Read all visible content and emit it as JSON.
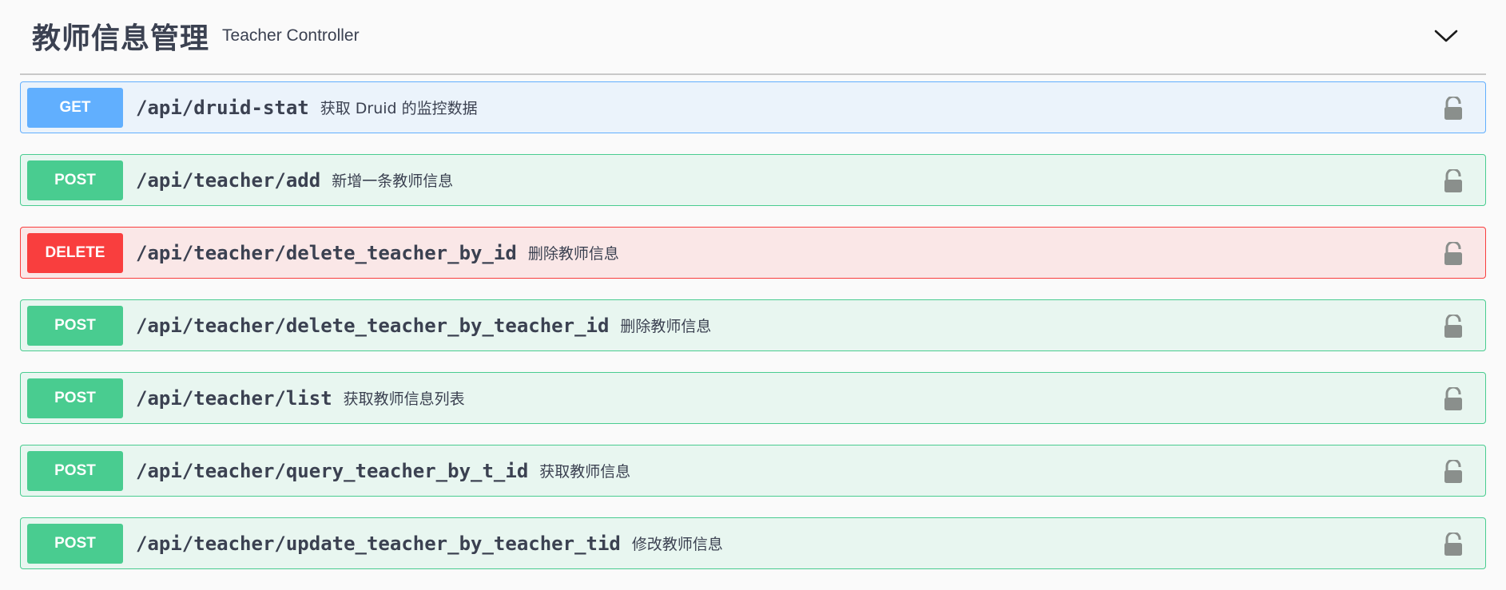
{
  "section": {
    "title": "教师信息管理",
    "subtitle": "Teacher Controller",
    "toggle_icon": "chevron-down-icon"
  },
  "operations": [
    {
      "method": "GET",
      "path": "/api/druid-stat",
      "summary": "获取 Druid 的监控数据",
      "lock_icon": "unlocked-icon"
    },
    {
      "method": "POST",
      "path": "/api/teacher/add",
      "summary": "新增一条教师信息",
      "lock_icon": "unlocked-icon"
    },
    {
      "method": "DELETE",
      "path": "/api/teacher/delete_teacher_by_id",
      "summary": "删除教师信息",
      "lock_icon": "unlocked-icon"
    },
    {
      "method": "POST",
      "path": "/api/teacher/delete_teacher_by_teacher_id",
      "summary": "删除教师信息",
      "lock_icon": "unlocked-icon"
    },
    {
      "method": "POST",
      "path": "/api/teacher/list",
      "summary": "获取教师信息列表",
      "lock_icon": "unlocked-icon"
    },
    {
      "method": "POST",
      "path": "/api/teacher/query_teacher_by_t_id",
      "summary": "获取教师信息",
      "lock_icon": "unlocked-icon"
    },
    {
      "method": "POST",
      "path": "/api/teacher/update_teacher_by_teacher_tid",
      "summary": "修改教师信息",
      "lock_icon": "unlocked-icon"
    }
  ],
  "colors": {
    "get": "#61affe",
    "post": "#49cc90",
    "delete": "#f93e3e",
    "lock": "#8a8f8c",
    "text": "#3b4151"
  }
}
